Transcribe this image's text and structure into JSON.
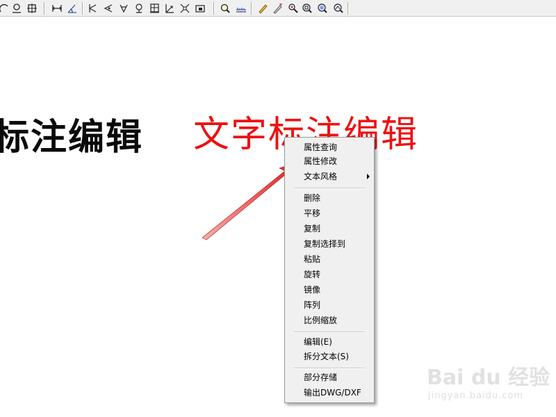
{
  "canvas": {
    "text_black": "标注编辑",
    "text_red": "文字标注编辑"
  },
  "context_menu": {
    "items": [
      {
        "label": "属性查询"
      },
      {
        "label": "属性修改"
      },
      {
        "label": "文本风格",
        "has_submenu": true
      },
      {
        "label": "删除"
      },
      {
        "label": "平移"
      },
      {
        "label": "复制"
      },
      {
        "label": "复制选择到"
      },
      {
        "label": "粘贴"
      },
      {
        "label": "旋转"
      },
      {
        "label": "镜像"
      },
      {
        "label": "阵列"
      },
      {
        "label": "比例缩放"
      },
      {
        "label": "编辑(E)"
      },
      {
        "label": "拆分文本(S)"
      },
      {
        "label": "部分存储"
      },
      {
        "label": "输出DWG/DXF"
      }
    ]
  },
  "watermark": {
    "logo": "Bai du 经验",
    "sub": "jingyan.baidu.com"
  },
  "colors": {
    "red_text": "#ee1111",
    "arrow_red": "#e01818",
    "menu_bg": "#f0f0f0",
    "toolbar_bg": "#f0f0f0"
  },
  "toolbar_icons": [
    "dimension-icon",
    "curve-icon",
    "frame-icon",
    "horizontal-dimension-icon",
    "angle-dimension-icon",
    "arc-dimension-icon",
    "angle-mark-icon",
    "radius-icon",
    "diameter-icon",
    "grid-icon",
    "coordinate-icon",
    "expand-icon",
    "view-box-icon",
    "query-icon",
    "ruler-icon",
    "pencil-icon",
    "magic-pencil-icon",
    "zoom-pan-icon",
    "zoom-in-icon",
    "zoom-window-icon",
    "zoom-all-icon"
  ]
}
